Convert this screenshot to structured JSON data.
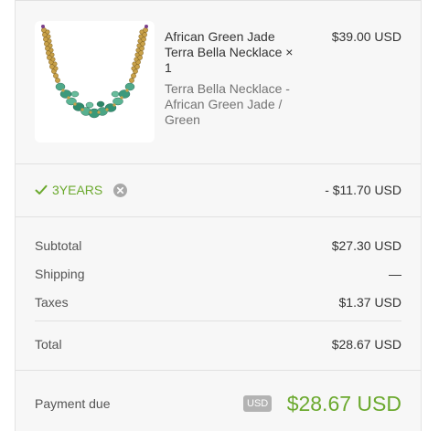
{
  "product": {
    "name": "African Green Jade Terra Bella Necklace",
    "quantity": "× 1",
    "variant": "Terra Bella Necklace - African Green Jade / Green",
    "price": "$39.00 USD",
    "image_alt": "necklace-image"
  },
  "discount": {
    "code": "3YEARS",
    "amount": "- $11.70 USD"
  },
  "totals": {
    "subtotal_label": "Subtotal",
    "subtotal_value": "$27.30 USD",
    "shipping_label": "Shipping",
    "shipping_value": "—",
    "taxes_label": "Taxes",
    "taxes_value": "$1.37 USD",
    "total_label": "Total",
    "total_value": "$28.67 USD"
  },
  "payment_due": {
    "label": "Payment due",
    "currency": "USD",
    "amount": "$28.67 USD"
  },
  "colors": {
    "accent_green": "#6ba92e",
    "panel_bg": "#f7f7f7",
    "badge_gray": "#b3b3b3"
  }
}
